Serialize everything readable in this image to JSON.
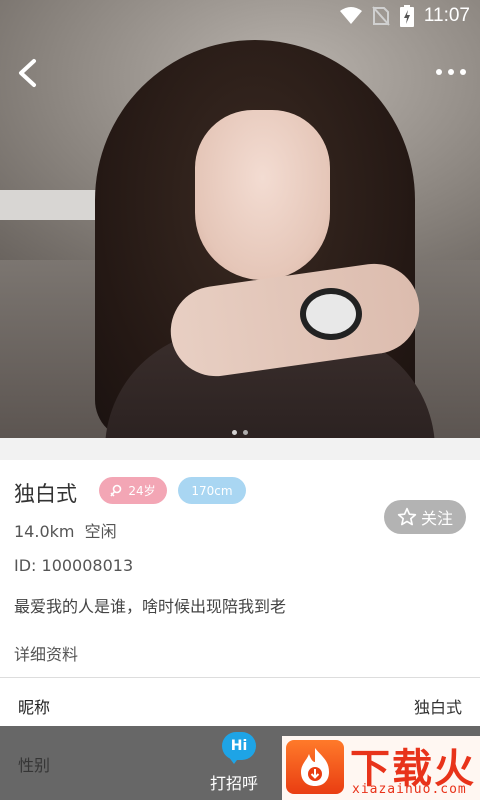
{
  "status_bar": {
    "time": "11:07",
    "icons": [
      "wifi-icon",
      "no-sim-icon",
      "battery-charging-icon"
    ]
  },
  "header": {
    "back_icon": "chevron-left-icon",
    "more_icon": "more-dots-icon"
  },
  "gallery": {
    "page_count": 2,
    "active_page": 1
  },
  "profile": {
    "name": "独白式",
    "age_badge": "24岁",
    "age_icon": "female-icon",
    "height_badge": "170cm",
    "distance_status": "14.0km  空闲",
    "id_text": "ID: 100008013",
    "motto": "最爱我的人是谁，啥时候出现陪我到老",
    "follow_label": "关注",
    "follow_icon": "star-outline-icon"
  },
  "details": {
    "title": "详细资料",
    "rows": [
      {
        "key": "昵称",
        "value": "独白式"
      },
      {
        "key": "性别",
        "value": ""
      }
    ]
  },
  "bottom_bar": {
    "greet_bubble": "Hi",
    "greet_label": "打招呼"
  },
  "watermark": {
    "title": "下载火",
    "url": "xiazaihuo.com"
  },
  "colors": {
    "age_badge": "#f3a6b5",
    "height_badge": "#a9d6f2",
    "follow_button": "#b3b3b3",
    "hi_bubble": "#1ea4e6",
    "watermark": "#e8331a"
  }
}
